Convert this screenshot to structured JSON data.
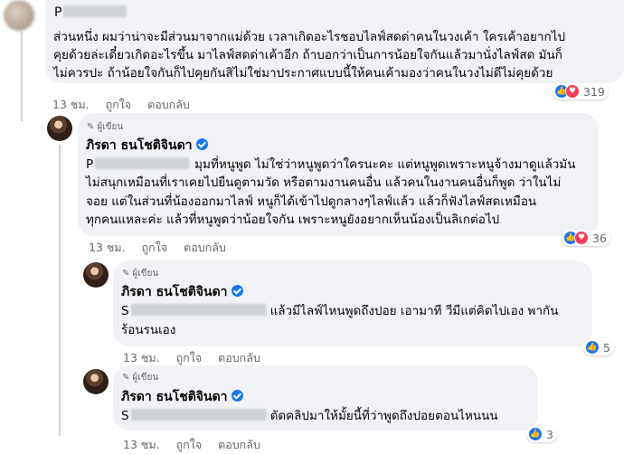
{
  "comment1": {
    "name": "P",
    "lines": [
      "ส่วนหนึ่ง ผมว่าน่าจะมีส่วนมาจากแม่ด้วย เวลาเกิดอะไรชอบไลฟ์สดด่าคนในวงเค้า ใครเค้าอยากไป",
      "คุยด้วยล่ะเดี๋ยวเกิดอะไรขึ้น มาไลฟ์สดด่าเค้าอีก ถ้าบอกว่าเป็นการน้อยใจกันแล้วมานั่งไลฟ์สด มันก็",
      "ไม่ควรปะ ถ้าน้อยใจกันก็ไปคุยกันสิไม่ใช่มาประกาศแบบนี้ให้คนเค้ามองว่าคนในวงไม่ดีไม่คุยด้วย"
    ],
    "time": "13 ชม.",
    "like_label": "ถูกใจ",
    "reply_label": "ตอบกลับ",
    "reaction_count": "319"
  },
  "reply1": {
    "author_tag": "ผู้เขียน",
    "name": "ภิรดา ธนโชติจินดา",
    "line1_prefix": "P",
    "line1_rest": "มุมที่หนูพูด ไม่ใช่ว่าหนูพูดว่าใครนะคะ แต่หนูพูดเพราะหนูจ้างมาดูแล้วมัน",
    "lines": [
      "ไม่สนุกเหมือนที่เราเคยไปยืนดูตามวัด หรือตามงานคนอื่น แล้วคนในงานคนอื่นก็พูด ว่าในไม่",
      "จอย แต่ในส่วนที่น้องออกมาไลฟ์ หนูก็ได้เข้าไปดูกลางๆไลฟ์แล้ว แล้วก็ฟังไลฟ์สดเหมือน",
      "ทุกคนแหละค่ะ แล้วที่หนูพูดว่าน้อยใจกัน เพราะหนูยังอยากเห็นน้องเป็นลิเกต่อไป"
    ],
    "time": "13 ชม.",
    "like_label": "ถูกใจ",
    "reply_label": "ตอบกลับ",
    "reaction_count": "36"
  },
  "reply2": {
    "author_tag": "ผู้เขียน",
    "name": "ภิรดา ธนโชติจินดา",
    "line1_prefix": "S",
    "line1_rest": "แล้วมีไลฟ์ไหนพูดถึงปอย เอามาที วีมีแต่คิดไปเอง พากัน",
    "line2": "ร้อนรนเอง",
    "time": "13 ชม.",
    "like_label": "ถูกใจ",
    "reply_label": "ตอบกลับ",
    "reaction_count": "5"
  },
  "reply3": {
    "author_tag": "ผู้เขียน",
    "name": "ภิรดา ธนโชติจินดา",
    "line1_prefix": "S",
    "line1_rest": "ตัดคลิปมาให้มั้ยนี้ที่ว่าพูดถึงปอยตอนไหนนน",
    "time": "13 ชม.",
    "like_label": "ถูกใจ",
    "reply_label": "ตอบกลับ",
    "reaction_count": "3"
  },
  "colors": {
    "like": "#1877f2",
    "love": "#f33e58",
    "bubble": "#f0f2f5",
    "meta": "#65676b"
  },
  "icons": {
    "like": "thumbs-up-icon",
    "love": "heart-icon",
    "verified": "verified-badge-icon",
    "author": "pen-icon"
  }
}
